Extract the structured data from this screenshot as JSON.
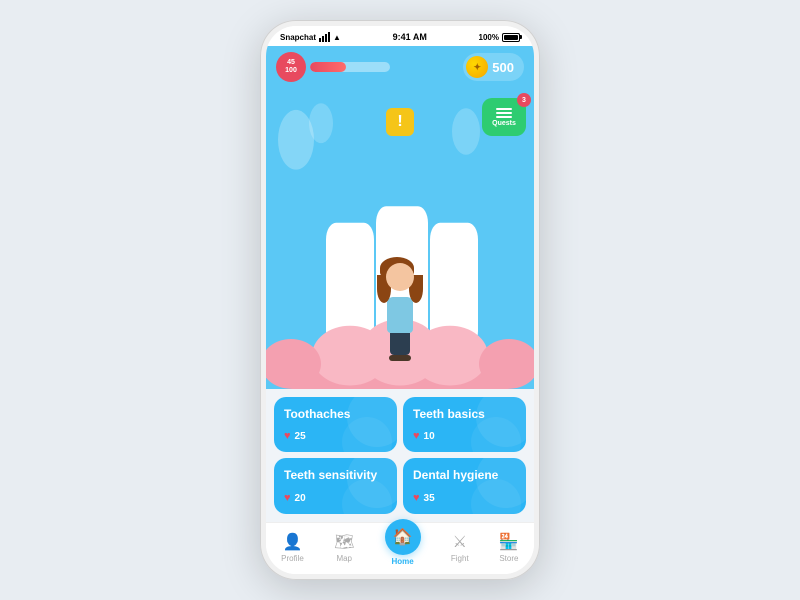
{
  "statusBar": {
    "carrier": "Snapchat",
    "time": "9:41 AM",
    "battery": "100%",
    "batteryWidth": "100%"
  },
  "hud": {
    "healthCurrent": "45",
    "healthMax": "100",
    "healthPercent": 45,
    "coins": "500",
    "questLabel": "Quests",
    "questBadge": "3"
  },
  "alert": {
    "symbol": "!"
  },
  "cards": [
    {
      "title": "Toothaches",
      "hearts": "25"
    },
    {
      "title": "Teeth basics",
      "hearts": "10"
    },
    {
      "title": "Teeth sensitivity",
      "hearts": "20"
    },
    {
      "title": "Dental hygiene",
      "hearts": "35"
    }
  ],
  "nav": [
    {
      "label": "Profile",
      "icon": "👤",
      "active": false
    },
    {
      "label": "Map",
      "icon": "🗺",
      "active": false
    },
    {
      "label": "Home",
      "icon": "🏠",
      "active": true
    },
    {
      "label": "Fight",
      "icon": "⚔",
      "active": false
    },
    {
      "label": "Store",
      "icon": "🏪",
      "active": false
    }
  ]
}
